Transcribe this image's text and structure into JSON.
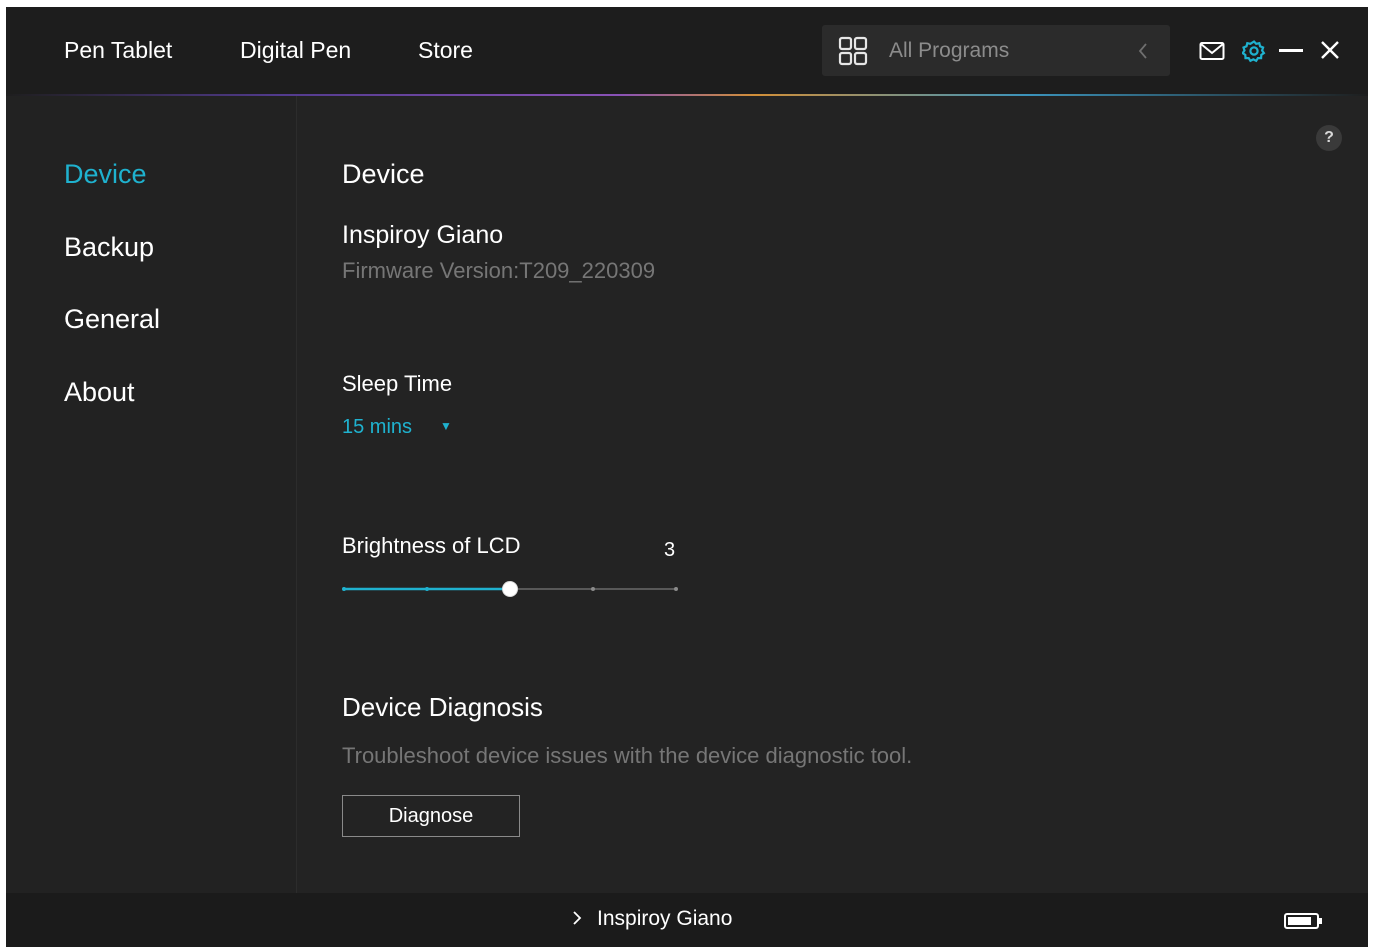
{
  "topbar": {
    "tabs": [
      "Pen Tablet",
      "Digital Pen",
      "Store"
    ],
    "program_selector": {
      "label": "All Programs",
      "icon": "grid-icon",
      "back_icon": "chevron-left-icon"
    },
    "icons": [
      "mail-icon",
      "gear-icon",
      "minimize-icon",
      "close-icon"
    ],
    "accent_color": "#1fb2cf"
  },
  "sidebar": {
    "items": [
      {
        "label": "Device",
        "active": true
      },
      {
        "label": "Backup",
        "active": false
      },
      {
        "label": "General",
        "active": false
      },
      {
        "label": "About",
        "active": false
      }
    ]
  },
  "main": {
    "help_label": "?",
    "section_title": "Device",
    "device_name": "Inspiroy Giano",
    "firmware": "Firmware Version:T209_220309",
    "sleep": {
      "label": "Sleep Time",
      "selected": "15 mins"
    },
    "brightness": {
      "label": "Brightness of LCD",
      "value": "3",
      "level": 3,
      "min": 1,
      "max": 5
    },
    "diagnosis": {
      "title": "Device Diagnosis",
      "description": "Troubleshoot device issues with the device diagnostic tool.",
      "button_label": "Diagnose"
    }
  },
  "statusbar": {
    "device_label": "Inspiroy Giano",
    "battery_icon": "battery-icon"
  }
}
